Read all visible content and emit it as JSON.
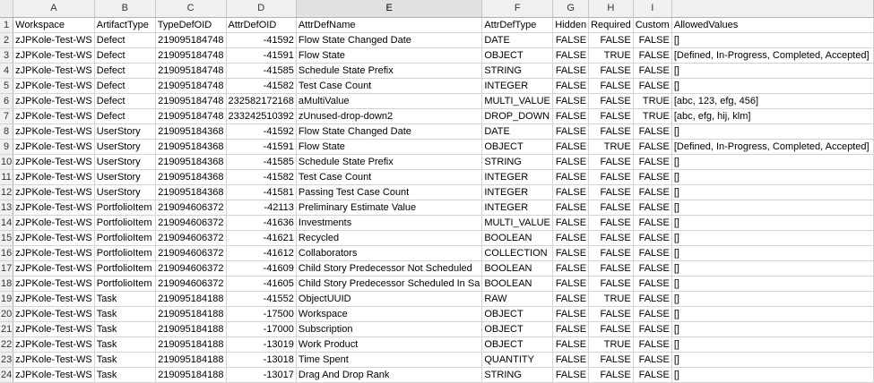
{
  "columns": [
    "A",
    "B",
    "C",
    "D",
    "E",
    "F",
    "G",
    "H",
    "I",
    ""
  ],
  "rows": [
    {
      "n": "1",
      "c": [
        "Workspace",
        "ArtifactType",
        "TypeDefOID",
        "AttrDefOID",
        "AttrDefName",
        "AttrDefType",
        "Hidden",
        "Required",
        "Custom",
        "AllowedValues"
      ]
    },
    {
      "n": "2",
      "c": [
        "zJPKole-Test-WS",
        "Defect",
        "219095184748",
        "-41592",
        "Flow State Changed Date",
        "DATE",
        "FALSE",
        "FALSE",
        "FALSE",
        "[]"
      ]
    },
    {
      "n": "3",
      "c": [
        "zJPKole-Test-WS",
        "Defect",
        "219095184748",
        "-41591",
        "Flow State",
        "OBJECT",
        "FALSE",
        "TRUE",
        "FALSE",
        "[Defined, In-Progress, Completed, Accepted]"
      ]
    },
    {
      "n": "4",
      "c": [
        "zJPKole-Test-WS",
        "Defect",
        "219095184748",
        "-41585",
        "Schedule State Prefix",
        "STRING",
        "FALSE",
        "FALSE",
        "FALSE",
        "[]"
      ]
    },
    {
      "n": "5",
      "c": [
        "zJPKole-Test-WS",
        "Defect",
        "219095184748",
        "-41582",
        "Test Case Count",
        "INTEGER",
        "FALSE",
        "FALSE",
        "FALSE",
        "[]"
      ]
    },
    {
      "n": "6",
      "c": [
        "zJPKole-Test-WS",
        "Defect",
        "219095184748",
        "232582172168",
        "aMultiValue",
        "MULTI_VALUE",
        "FALSE",
        "FALSE",
        "TRUE",
        "[abc, 123, efg, 456]"
      ]
    },
    {
      "n": "7",
      "c": [
        "zJPKole-Test-WS",
        "Defect",
        "219095184748",
        "233242510392",
        "zUnused-drop-down2",
        "DROP_DOWN",
        "FALSE",
        "FALSE",
        "TRUE",
        "[abc, efg, hij, klm]"
      ]
    },
    {
      "n": "8",
      "c": [
        "zJPKole-Test-WS",
        "UserStory",
        "219095184368",
        "-41592",
        "Flow State Changed Date",
        "DATE",
        "FALSE",
        "FALSE",
        "FALSE",
        "[]"
      ]
    },
    {
      "n": "9",
      "c": [
        "zJPKole-Test-WS",
        "UserStory",
        "219095184368",
        "-41591",
        "Flow State",
        "OBJECT",
        "FALSE",
        "TRUE",
        "FALSE",
        "[Defined, In-Progress, Completed, Accepted]"
      ]
    },
    {
      "n": "10",
      "c": [
        "zJPKole-Test-WS",
        "UserStory",
        "219095184368",
        "-41585",
        "Schedule State Prefix",
        "STRING",
        "FALSE",
        "FALSE",
        "FALSE",
        "[]"
      ]
    },
    {
      "n": "11",
      "c": [
        "zJPKole-Test-WS",
        "UserStory",
        "219095184368",
        "-41582",
        "Test Case Count",
        "INTEGER",
        "FALSE",
        "FALSE",
        "FALSE",
        "[]"
      ]
    },
    {
      "n": "12",
      "c": [
        "zJPKole-Test-WS",
        "UserStory",
        "219095184368",
        "-41581",
        "Passing Test Case Count",
        "INTEGER",
        "FALSE",
        "FALSE",
        "FALSE",
        "[]"
      ]
    },
    {
      "n": "13",
      "c": [
        "zJPKole-Test-WS",
        "PortfolioItem",
        "219094606372",
        "-42113",
        "Preliminary Estimate Value",
        "INTEGER",
        "FALSE",
        "FALSE",
        "FALSE",
        "[]"
      ]
    },
    {
      "n": "14",
      "c": [
        "zJPKole-Test-WS",
        "PortfolioItem",
        "219094606372",
        "-41636",
        "Investments",
        "MULTI_VALUE",
        "FALSE",
        "FALSE",
        "FALSE",
        "[]"
      ]
    },
    {
      "n": "15",
      "c": [
        "zJPKole-Test-WS",
        "PortfolioItem",
        "219094606372",
        "-41621",
        "Recycled",
        "BOOLEAN",
        "FALSE",
        "FALSE",
        "FALSE",
        "[]"
      ]
    },
    {
      "n": "16",
      "c": [
        "zJPKole-Test-WS",
        "PortfolioItem",
        "219094606372",
        "-41612",
        "Collaborators",
        "COLLECTION",
        "FALSE",
        "FALSE",
        "FALSE",
        "[]"
      ]
    },
    {
      "n": "17",
      "c": [
        "zJPKole-Test-WS",
        "PortfolioItem",
        "219094606372",
        "-41609",
        "Child Story Predecessor Not Scheduled",
        "BOOLEAN",
        "FALSE",
        "FALSE",
        "FALSE",
        "[]"
      ]
    },
    {
      "n": "18",
      "c": [
        "zJPKole-Test-WS",
        "PortfolioItem",
        "219094606372",
        "-41605",
        "Child Story Predecessor Scheduled In Sa",
        "BOOLEAN",
        "FALSE",
        "FALSE",
        "FALSE",
        "[]"
      ]
    },
    {
      "n": "19",
      "c": [
        "zJPKole-Test-WS",
        "Task",
        "219095184188",
        "-41552",
        "ObjectUUID",
        "RAW",
        "FALSE",
        "TRUE",
        "FALSE",
        "[]"
      ]
    },
    {
      "n": "20",
      "c": [
        "zJPKole-Test-WS",
        "Task",
        "219095184188",
        "-17500",
        "Workspace",
        "OBJECT",
        "FALSE",
        "FALSE",
        "FALSE",
        "[]"
      ]
    },
    {
      "n": "21",
      "c": [
        "zJPKole-Test-WS",
        "Task",
        "219095184188",
        "-17000",
        "Subscription",
        "OBJECT",
        "FALSE",
        "FALSE",
        "FALSE",
        "[]"
      ]
    },
    {
      "n": "22",
      "c": [
        "zJPKole-Test-WS",
        "Task",
        "219095184188",
        "-13019",
        "Work Product",
        "OBJECT",
        "FALSE",
        "TRUE",
        "FALSE",
        "[]"
      ]
    },
    {
      "n": "23",
      "c": [
        "zJPKole-Test-WS",
        "Task",
        "219095184188",
        "-13018",
        "Time Spent",
        "QUANTITY",
        "FALSE",
        "FALSE",
        "FALSE",
        "[]"
      ]
    },
    {
      "n": "24",
      "c": [
        "zJPKole-Test-WS",
        "Task",
        "219095184188",
        "-13017",
        "Drag And Drop Rank",
        "STRING",
        "FALSE",
        "FALSE",
        "FALSE",
        "[]"
      ]
    }
  ]
}
